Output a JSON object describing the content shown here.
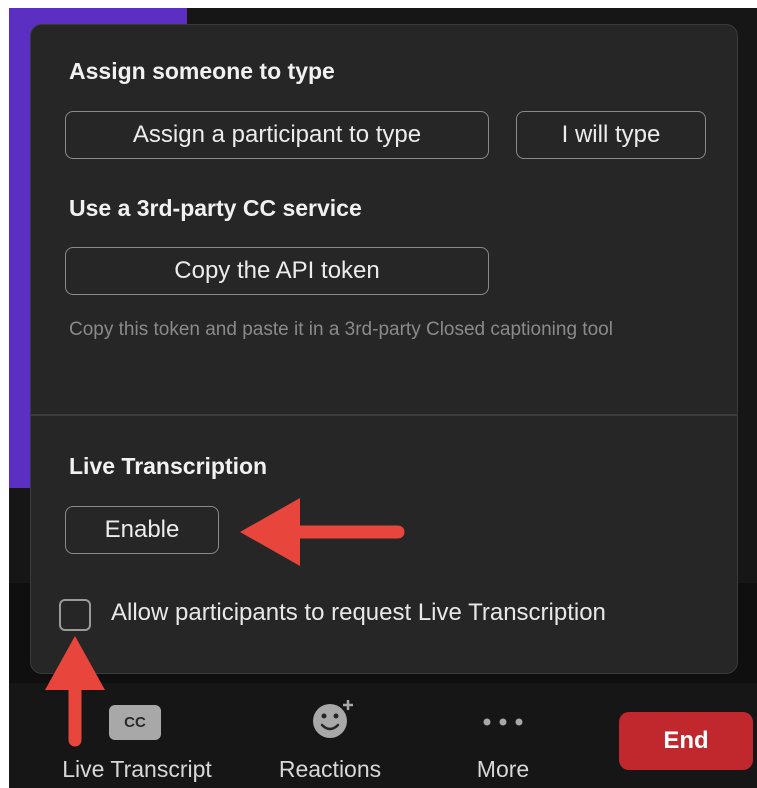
{
  "cc_panel": {
    "assign_heading": "Assign someone to type",
    "assign_participant_label": "Assign a participant to type",
    "i_will_type_label": "I will type",
    "third_party_heading": "Use a 3rd-party CC service",
    "copy_api_label": "Copy the API token",
    "copy_api_help": "Copy this token and paste it in a 3rd-party Closed captioning tool"
  },
  "live_transcription": {
    "heading": "Live Transcription",
    "enable_label": "Enable",
    "allow_request_label": "Allow participants to request Live Transcription",
    "allow_request_checked": false
  },
  "toolbar": {
    "cc_icon_text": "CC",
    "live_transcript_label": "Live Transcript",
    "reactions_label": "Reactions",
    "more_label": "More",
    "end_label": "End"
  },
  "colors": {
    "arrow": "#e8453c",
    "end_button": "#c0282d",
    "accent_purple": "#5a2fc2"
  }
}
